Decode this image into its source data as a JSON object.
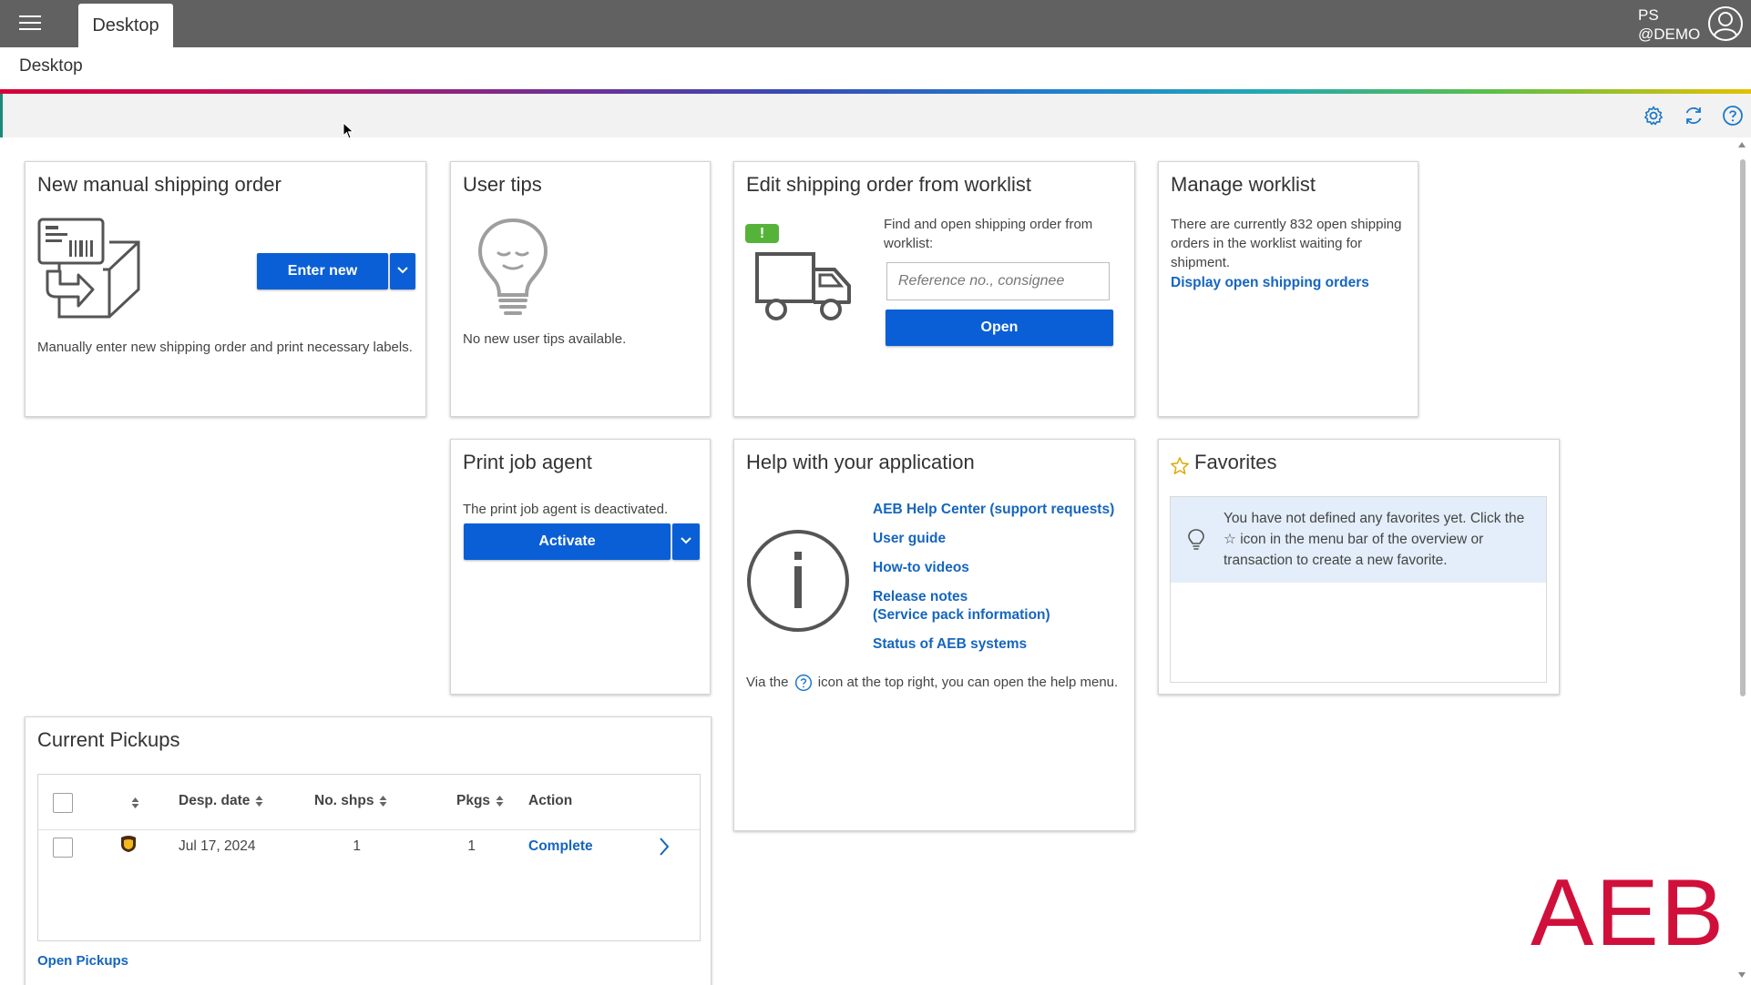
{
  "topbar": {
    "tab": "Desktop",
    "user_line1": "PS",
    "user_line2": "@DEMO"
  },
  "breadcrumb": {
    "title": "Desktop"
  },
  "cards": {
    "new_order": {
      "title": "New manual shipping order",
      "button": "Enter new",
      "desc": "Manually enter new shipping order and print necessary labels."
    },
    "user_tips": {
      "title": "User tips",
      "desc": "No new user tips available."
    },
    "edit_order": {
      "title": "Edit shipping order from worklist",
      "badge": "!",
      "desc": "Find and open shipping order from worklist:",
      "placeholder": "Reference no., consignee",
      "button": "Open"
    },
    "manage_worklist": {
      "title": "Manage worklist",
      "desc": "There are currently 832 open shipping orders in the worklist waiting for shipment.",
      "link": "Display open shipping orders"
    },
    "print_agent": {
      "title": "Print job agent",
      "desc": "The print job agent is deactivated.",
      "button": "Activate"
    },
    "help": {
      "title": "Help with your application",
      "links": [
        "AEB Help Center (support requests)",
        "User guide",
        "How-to videos",
        "Release notes",
        "(Service pack information)",
        "Status of AEB systems"
      ],
      "via_prefix": "Via the",
      "via_suffix": "icon at the top right, you can open the help",
      "via_end": "menu."
    },
    "favorites": {
      "title": "Favorites",
      "note": "You have not defined any favorites yet. Click the ☆ icon in the menu bar of the overview or transaction to create a new favorite."
    },
    "pickups": {
      "title": "Current Pickups",
      "columns": [
        "Desp. date",
        "No. shps",
        "Pkgs",
        "Action"
      ],
      "rows": [
        {
          "date": "Jul 17, 2024",
          "shipments": "1",
          "packages": "1",
          "action": "Complete"
        }
      ],
      "link": "Open Pickups"
    }
  },
  "logo": "AEB",
  "colors": {
    "accent": "#0a5fd6",
    "link": "#1565c0",
    "brand": "#d0103a",
    "topbar": "#616161"
  }
}
